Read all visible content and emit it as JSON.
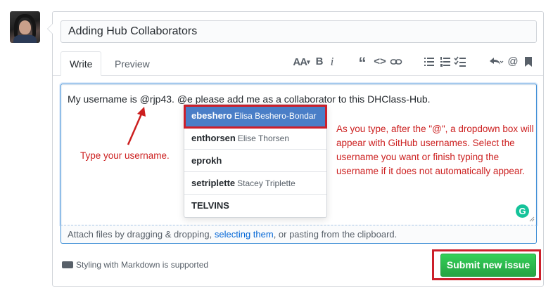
{
  "issue": {
    "title_value": "Adding Hub Collaborators",
    "body_text": "My username is @rjp43. @e please add me as a collaborator to this DHClass-Hub."
  },
  "tabs": [
    {
      "label": "Write",
      "selected": true
    },
    {
      "label": "Preview",
      "selected": false
    }
  ],
  "toolbar": {
    "text_size_label": "AA",
    "icons": [
      "text-size-icon",
      "bold-icon",
      "italic-icon",
      "quote-icon",
      "code-icon",
      "link-icon",
      "bulleted-list-icon",
      "numbered-list-icon",
      "task-list-icon",
      "reply-icon",
      "mention-icon",
      "bookmark-icon"
    ]
  },
  "mention_suggestions": [
    {
      "login": "ebeshero",
      "name": "Elisa Beshero-Bondar",
      "selected": true
    },
    {
      "login": "enthorsen",
      "name": "Elise Thorsen",
      "selected": false
    },
    {
      "login": "eprokh",
      "name": "",
      "selected": false
    },
    {
      "login": "setriplette",
      "name": "Stacey Triplette",
      "selected": false
    },
    {
      "login": "TELVINS",
      "name": "",
      "selected": false
    }
  ],
  "attach": {
    "before": "Attach files by dragging & dropping, ",
    "link": "selecting them",
    "after": ", or pasting from the clipboard."
  },
  "annotations": {
    "left": "Type your username.",
    "right": "As you type, after the \"@\", a dropdown box will appear with GitHub usernames. Select the username you want or finish typing the username if it does not automatically appear."
  },
  "footer": {
    "markdown_note": "Styling with Markdown is supported",
    "submit_label": "Submit new issue"
  },
  "grammarly_glyph": "G",
  "colors": {
    "submit_green": "#28a745",
    "annotation_red": "#cc1f1f",
    "selected_suggestion": "#4a7ec7",
    "focus_blue": "#3f8fd6"
  }
}
